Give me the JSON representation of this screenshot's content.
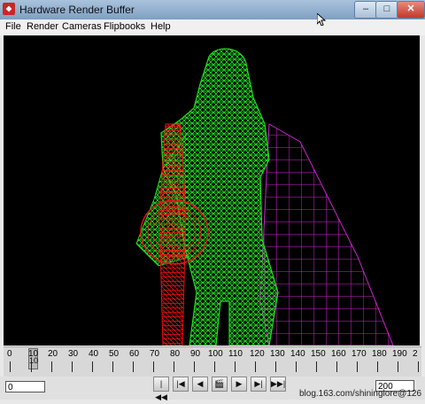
{
  "window": {
    "title": "Hardware Render Buffer"
  },
  "title_buttons": {
    "minimize": "–",
    "maximize": "□",
    "close": "✕"
  },
  "menu": [
    "File",
    "Render",
    "Cameras",
    "Flipbooks",
    "Help"
  ],
  "timeline": {
    "labels": [
      "0",
      "10",
      "20",
      "30",
      "40",
      "50",
      "60",
      "70",
      "80",
      "90",
      "100",
      "110",
      "120",
      "130",
      "140",
      "150",
      "160",
      "170",
      "180",
      "190",
      "2"
    ],
    "current_frame_label": "10"
  },
  "start_field": "0",
  "end_field": "200",
  "playback": [
    "|◀◀",
    "|◀",
    "◀",
    "🎬",
    "▶",
    "▶|",
    "▶▶|"
  ],
  "watermark": "blog.163.com/shininglore@126",
  "colors": {
    "viewport_bg": "#000000",
    "figure": "#22dd22",
    "sword": "#ee1111",
    "cloth": "#cc22cc"
  }
}
